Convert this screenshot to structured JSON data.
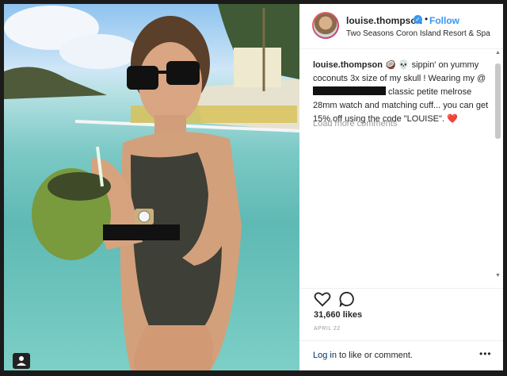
{
  "post": {
    "username": "louise.thompson",
    "follow_label": "Follow",
    "location": "Two Seasons Coron Island Resort & Spa",
    "caption_user": "louise.thompson",
    "caption_part1": "🥥 💀 sippin' on yummy coconuts 3x size of my skull ! Wearing my @",
    "caption_part2": " classic petite melrose 28mm watch and matching cuff... you can get 15% off using the code \"LOUISE\". ❤️",
    "load_more": "Load more comments",
    "likes": "31,660 likes",
    "date": "APRIL 22",
    "login_link": "Log in",
    "login_suffix": " to like or comment.",
    "more_label": "•••"
  },
  "icons": {
    "verified": "verified-badge-icon",
    "heart": "heart-icon",
    "comment": "comment-icon",
    "user_tag": "user-tag-icon",
    "more": "more-options-icon"
  },
  "colors": {
    "link_blue": "#3897f0",
    "text": "#262626",
    "muted": "#999999"
  }
}
